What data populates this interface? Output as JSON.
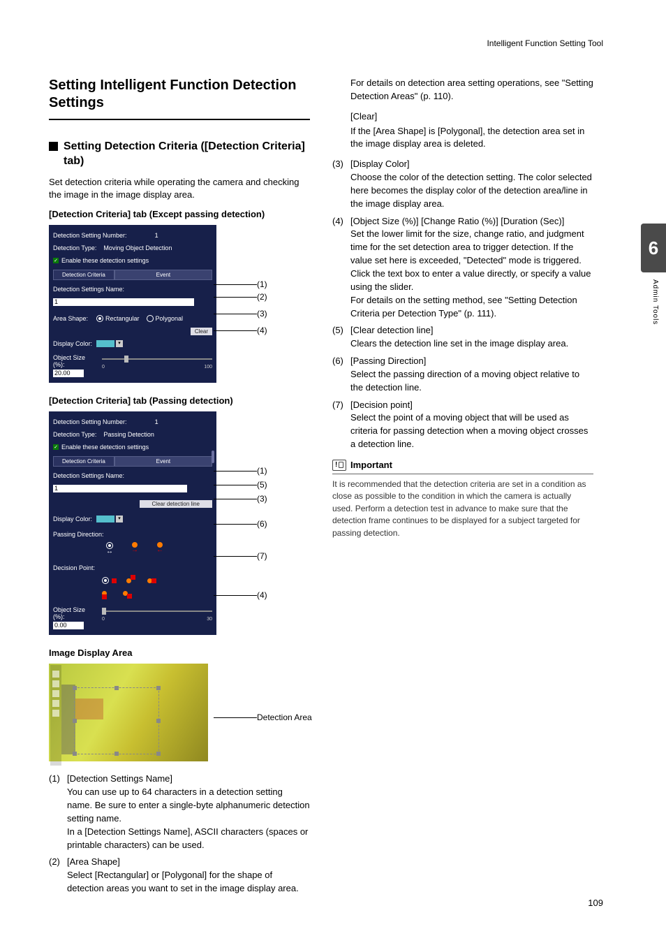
{
  "header": {
    "breadcrumb": "Intelligent Function Setting Tool"
  },
  "sideTab": {
    "chapter": "6",
    "label": "Admin Tools"
  },
  "pageNumber": "109",
  "left": {
    "h1": "Setting Intelligent Function Detection Settings",
    "h2": "Setting Detection Criteria ([Detection Criteria] tab)",
    "intro": "Set detection criteria while operating the camera and checking the image in the image display area.",
    "cap1": "[Detection Criteria] tab (Except passing detection)",
    "cap2": "[Detection Criteria] tab (Passing detection)",
    "imgCap": "Image Display Area",
    "detAreaLabel": "Detection Area",
    "items": {
      "i1": {
        "num": "(1)",
        "label": "[Detection Settings Name]",
        "p1": "You can use up to 64 characters in a detection setting name. Be sure to enter a single-byte alphanumeric detection setting name.",
        "p2": "In a [Detection Settings Name], ASCII characters (spaces or printable characters) can be used."
      },
      "i2": {
        "num": "(2)",
        "label": "[Area Shape]",
        "p1": "Select [Rectangular] or [Polygonal] for the shape of detection areas you want to set in the image display area."
      }
    }
  },
  "shot1": {
    "numLabel": "Detection Setting Number:",
    "numVal": "1",
    "typeLabel": "Detection Type:",
    "typeVal": "Moving Object Detection",
    "enable": "Enable these detection settings",
    "tab1": "Detection Criteria",
    "tab2": "Event",
    "nameLabel": "Detection Settings Name:",
    "nameVal": "1",
    "shapeLabel": "Area Shape:",
    "shapeOpt1": "Rectangular",
    "shapeOpt2": "Polygonal",
    "clearBtn": "Clear",
    "colorLabel": "Display Color:",
    "sizeLabel": "Object Size (%):",
    "sizeVal": "20.00",
    "slMin": "0",
    "slMax": "100"
  },
  "shot2": {
    "numLabel": "Detection Setting Number:",
    "numVal": "1",
    "typeLabel": "Detection Type:",
    "typeVal": "Passing Detection",
    "enable": "Enable these detection settings",
    "tab1": "Detection Criteria",
    "tab2": "Event",
    "nameLabel": "Detection Settings Name:",
    "nameVal": "1",
    "clearLineBtn": "Clear detection line",
    "colorLabel": "Display Color:",
    "passDirLabel": "Passing Direction:",
    "decPointLabel": "Decision Point:",
    "sizeLabel": "Object Size (%):",
    "sizeVal": "0.00",
    "slMin": "0",
    "slMax": "30"
  },
  "right": {
    "top1": "For details on detection area setting operations, see \"Setting Detection Areas\" (p. 110).",
    "clearHdr": "[Clear]",
    "clearBody": "If the [Area Shape] is [Polygonal], the detection area set in the image display area is deleted.",
    "i3": {
      "num": "(3)",
      "label": "[Display Color]",
      "body": "Choose the color of the detection setting. The color selected here becomes the display color of the detection area/line in the image display area."
    },
    "i4": {
      "num": "(4)",
      "label": "[Object Size (%)] [Change Ratio (%)] [Duration (Sec)]",
      "p1": "Set the lower limit for the size, change ratio, and judgment time for the set detection area to trigger detection. If the value set here is exceeded, \"Detected\" mode is triggered.",
      "p2": "Click the text box to enter a value directly, or specify a value using the slider.",
      "p3": "For details on the setting method, see \"Setting Detection Criteria per Detection Type\" (p. 111)."
    },
    "i5": {
      "num": "(5)",
      "label": "[Clear detection line]",
      "body": "Clears the detection line set in the image display area."
    },
    "i6": {
      "num": "(6)",
      "label": "[Passing Direction]",
      "body": "Select the passing direction of a moving object relative to the detection line."
    },
    "i7": {
      "num": "(7)",
      "label": "[Decision point]",
      "body": "Select the point of a moving object that will be used as criteria for passing detection when a moving object crosses a detection line."
    },
    "importantHdr": "Important",
    "importantBody": "It is recommended that the detection criteria are set in a condition as close as possible to the condition in which the camera is actually used. Perform a detection test in advance to make sure that the detection frame continues to be displayed for a subject targeted for passing detection."
  },
  "callouts": {
    "c1": "(1)",
    "c2": "(2)",
    "c3": "(3)",
    "c4": "(4)",
    "c5": "(5)",
    "c6": "(6)",
    "c7": "(7)"
  }
}
